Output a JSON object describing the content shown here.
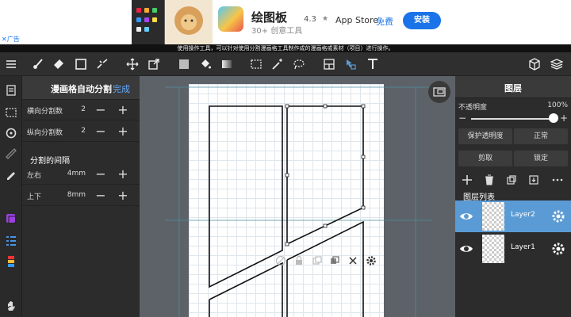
{
  "ad": {
    "title": "绘图板",
    "subtitle": "30+ 创意工具",
    "rating": "4.3",
    "store": "App Store",
    "free": "免费",
    "install": "安装",
    "ad_marker": "✕广告"
  },
  "hint": "使用操作工具，可以针对使用分割漫画格工具制作成的漫画格或素材（项目）进行操作。",
  "toolbar": {
    "icons": [
      "menu-icon",
      "layers-icon",
      "brush-icon",
      "eraser-icon",
      "rect-icon",
      "fill-icon",
      "move-icon",
      "transform-icon",
      "color-swatch-icon",
      "bucket-icon",
      "gradient-icon",
      "select-icon",
      "magic-wand-icon",
      "lasso-icon",
      "panel-icon",
      "operation-icon",
      "text-icon",
      "material-icon",
      "layer-stack-icon"
    ]
  },
  "left_panel": {
    "title": "漫画格自动分割",
    "done": "完成",
    "rows": [
      {
        "label": "横向分割数",
        "value": "2"
      },
      {
        "label": "纵向分割数",
        "value": "2"
      }
    ],
    "section": "分割的间隔",
    "gap_rows": [
      {
        "label": "左右",
        "value": "4mm"
      },
      {
        "label": "上下",
        "value": "8mm"
      }
    ]
  },
  "right_panel": {
    "title": "图层",
    "opacity_label": "不透明度",
    "opacity_value": "100%",
    "opacity_fraction": 1.0,
    "protect_alpha": "保护透明度",
    "blend_mode": "正常",
    "clip": "剪取",
    "lock": "锁定",
    "list_title": "图层列表",
    "layers": [
      {
        "name": "Layer2",
        "selected": true
      },
      {
        "name": "Layer1",
        "selected": false
      }
    ]
  },
  "colors": {
    "accent": "#5b9bd5",
    "selected_layer": "#5b9bd5",
    "done_link": "#5fa8ff",
    "install_button": "#1a73e8"
  }
}
